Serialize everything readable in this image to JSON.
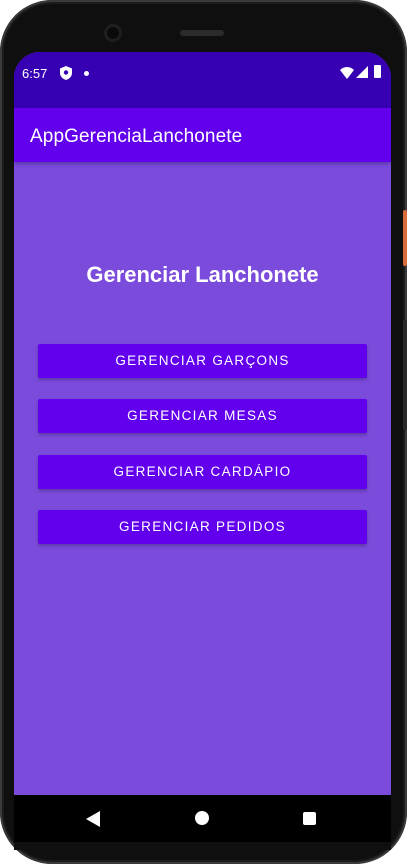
{
  "status_bar": {
    "time": "6:57",
    "icons": [
      "shield-icon",
      "notification-dot-icon",
      "wifi-icon",
      "signal-icon",
      "battery-icon"
    ]
  },
  "app_bar": {
    "title": "AppGerenciaLanchonete"
  },
  "main": {
    "heading": "Gerenciar Lanchonete",
    "buttons": [
      {
        "label": "GERENCIAR GARÇONS"
      },
      {
        "label": "GERENCIAR MESAS"
      },
      {
        "label": "GERENCIAR CARDÁPIO"
      },
      {
        "label": "GERENCIAR PEDIDOS"
      }
    ]
  },
  "nav_bar": {
    "icons": [
      "back-icon",
      "home-icon",
      "recent-apps-icon"
    ]
  },
  "colors": {
    "status_bar": "#3700b3",
    "app_bar": "#6200ee",
    "background": "#7b4bdc",
    "button": "#6200ee",
    "text": "#ffffff"
  }
}
